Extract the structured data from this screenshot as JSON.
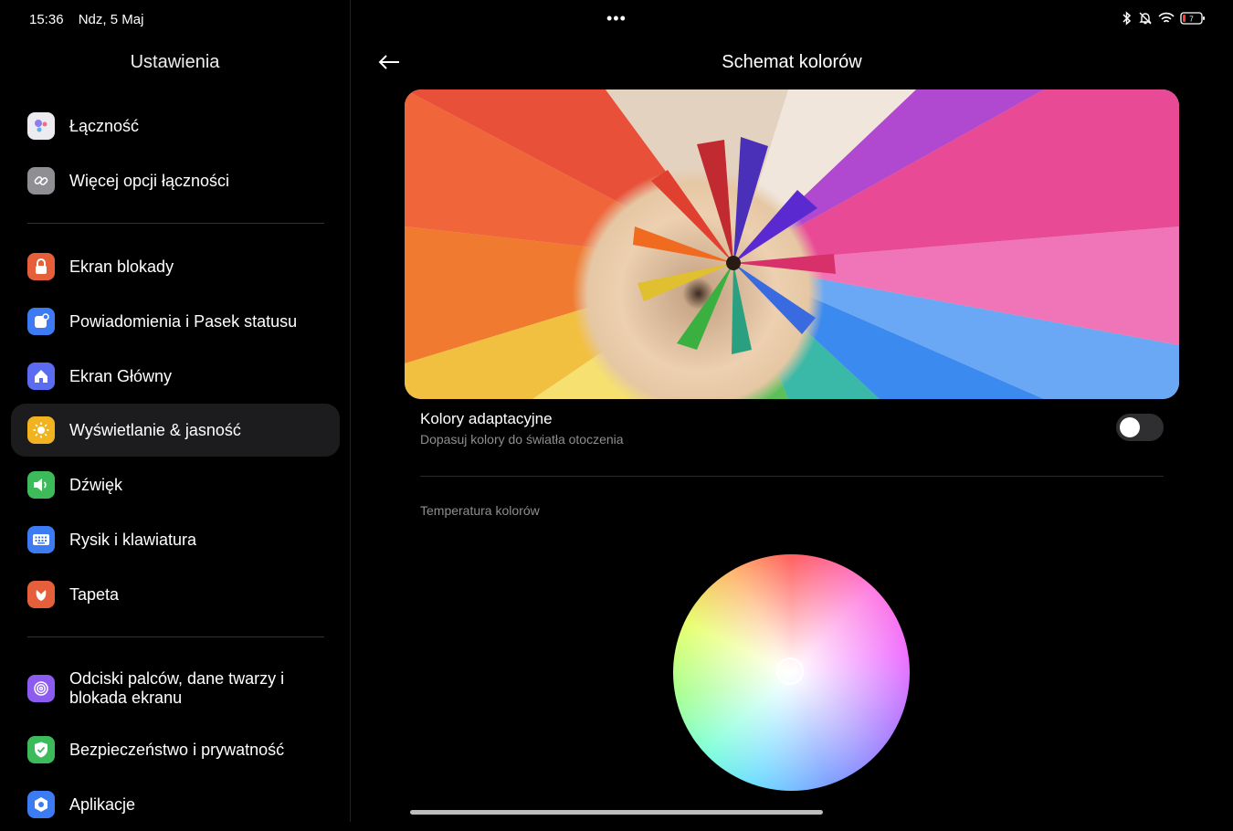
{
  "status_bar": {
    "time": "15:36",
    "date": "Ndz, 5 Maj",
    "more": "•••",
    "battery": "7"
  },
  "sidebar": {
    "title": "Ustawienia",
    "items": [
      {
        "label": "Łączność",
        "icon": "connectivity-icon",
        "color": "#e9e9ee"
      },
      {
        "label": "Więcej opcji łączności",
        "icon": "link-icon",
        "color": "#8e8e93"
      },
      {
        "label": "Ekran blokady",
        "icon": "lock-icon",
        "color": "#e5603a"
      },
      {
        "label": "Powiadomienia i Pasek statusu",
        "icon": "notification-icon",
        "color": "#3c7bf2"
      },
      {
        "label": "Ekran Główny",
        "icon": "home-icon",
        "color": "#5b6cf0"
      },
      {
        "label": "Wyświetlanie & jasność",
        "icon": "sun-icon",
        "color": "#f2b321",
        "active": true
      },
      {
        "label": "Dźwięk",
        "icon": "speaker-icon",
        "color": "#3dbb5a"
      },
      {
        "label": "Rysik i klawiatura",
        "icon": "keyboard-icon",
        "color": "#3c7bf2"
      },
      {
        "label": "Tapeta",
        "icon": "wallpaper-icon",
        "color": "#e5603a"
      },
      {
        "label": "Odciski palców, dane twarzy i blokada ekranu",
        "icon": "fingerprint-icon",
        "color": "#8c5cf0"
      },
      {
        "label": "Bezpieczeństwo i prywatność",
        "icon": "shield-icon",
        "color": "#3dbb5a"
      },
      {
        "label": "Aplikacje",
        "icon": "apps-icon",
        "color": "#3c7bf2"
      }
    ]
  },
  "main": {
    "title": "Schemat kolorów",
    "adaptive": {
      "title": "Kolory adaptacyjne",
      "subtitle": "Dopasuj kolory do światła otoczenia",
      "enabled": false
    },
    "temperature_label": "Temperatura kolorów"
  }
}
